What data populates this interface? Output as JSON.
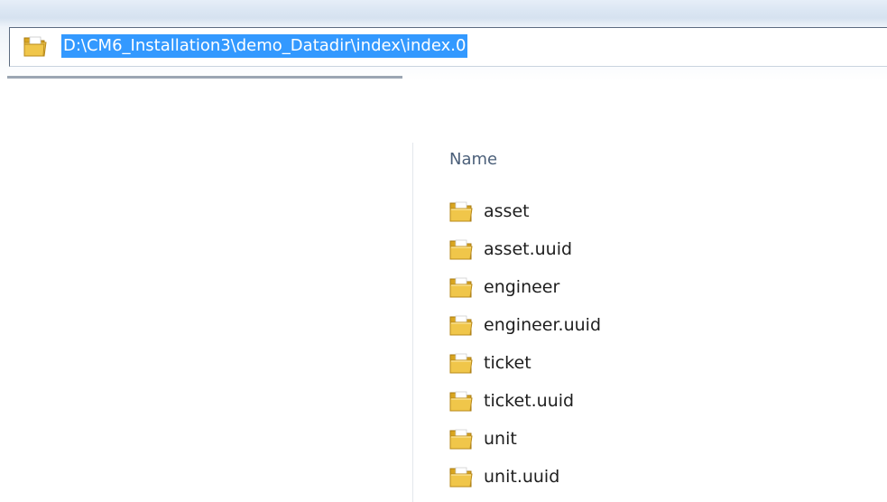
{
  "address_bar": {
    "path": "D:\\CM6_Installation3\\demo_Datadir\\index\\index.0",
    "icon": "folder-icon"
  },
  "file_list": {
    "column_header": "Name",
    "items": [
      {
        "name": "asset",
        "icon": "folder-icon"
      },
      {
        "name": "asset.uuid",
        "icon": "folder-icon"
      },
      {
        "name": "engineer",
        "icon": "folder-icon"
      },
      {
        "name": "engineer.uuid",
        "icon": "folder-icon"
      },
      {
        "name": "ticket",
        "icon": "folder-icon"
      },
      {
        "name": "ticket.uuid",
        "icon": "folder-icon"
      },
      {
        "name": "unit",
        "icon": "folder-icon"
      },
      {
        "name": "unit.uuid",
        "icon": "folder-icon"
      }
    ]
  },
  "colors": {
    "selection": "#3399ff",
    "folder_yellow": "#f0c64a",
    "header_text": "#4c607a"
  }
}
